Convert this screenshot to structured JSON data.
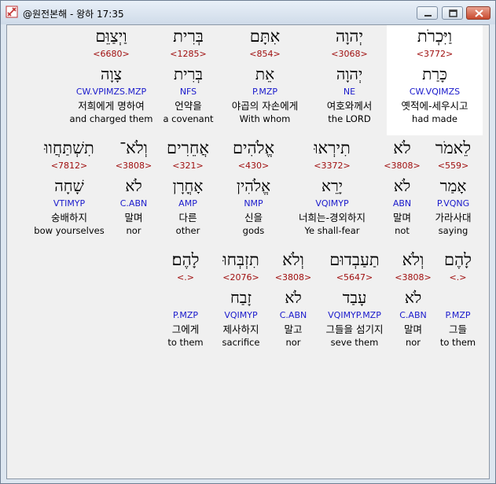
{
  "window": {
    "title": "@원전본해 - 왕하 17:35"
  },
  "rows": [
    {
      "words": [
        {
          "heb": "וַיִּכְרֹת",
          "num": "<3772>",
          "root": "כָּרַת",
          "pars": "CW.VQIMZS",
          "kor": "옛적에-세우시고",
          "eng": "had made",
          "selected": true
        },
        {
          "heb": "יְהוָה",
          "num": "<3068>",
          "root": "יְהוָה",
          "pars": "NE",
          "kor": "여호와께서",
          "eng": "the LORD"
        },
        {
          "heb": "אִתָּם",
          "num": "<854>",
          "root": "אֵת",
          "pars": "P.MZP",
          "kor": "야곱의 자손에게",
          "eng": "With whom"
        },
        {
          "heb": "בְּרִית",
          "num": "<1285>",
          "root": "בְּרִית",
          "pars": "NFS",
          "kor": "언약을",
          "eng": "a covenant"
        },
        {
          "heb": "וַיְצַוֵּם",
          "num": "<6680>",
          "root": "צָוָה",
          "pars": "CW.VPIMZS.MZP",
          "kor": "저희에게 명하여",
          "eng": "and charged them"
        }
      ]
    },
    {
      "words": [
        {
          "heb": "לֵאמֹר",
          "num": "<559>",
          "root": "אָמַר",
          "pars": "P.VQNG",
          "kor": "가라사대",
          "eng": "saying"
        },
        {
          "heb": "לֹא",
          "num": "<3808>",
          "root": "לֹא",
          "pars": "ABN",
          "kor": "말며",
          "eng": "not"
        },
        {
          "heb": "תִירְאוּ",
          "num": "<3372>",
          "root": "יָרֵא",
          "pars": "VQIMYP",
          "kor": "너희는-경외하지",
          "eng": "Ye shall-fear"
        },
        {
          "heb": "אֱלֹהִים",
          "num": "<430>",
          "root": "אֱלֹהִין",
          "pars": "NMP",
          "kor": "신을",
          "eng": "gods"
        },
        {
          "heb": "אֲחֵרִים",
          "num": "<321>",
          "root": "אָחֳרָן",
          "pars": "AMP",
          "kor": "다른",
          "eng": "other"
        },
        {
          "heb": "וְלֹא־",
          "num": "<3808>",
          "root": "לֹא",
          "pars": "C.ABN",
          "kor": "말며",
          "eng": "nor"
        },
        {
          "heb": "תִשְׁתַּחֲווּ",
          "num": "<7812>",
          "root": "שָׁחָה",
          "pars": "VTIMYP",
          "kor": "숭배하지",
          "eng": "bow yourselves"
        }
      ]
    },
    {
      "words": [
        {
          "heb": "לָהֶם",
          "num": "<.>",
          "root": "",
          "pars": "P.MZP",
          "kor": "그들",
          "eng": "to them"
        },
        {
          "heb": "וְלֹא",
          "num": "<3808>",
          "root": "לֹא",
          "pars": "C.ABN",
          "kor": "말며",
          "eng": "nor"
        },
        {
          "heb": "תַעַבְדוּם",
          "num": "<5647>",
          "root": "עָבַד",
          "pars": "VQIMYP.MZP",
          "kor": "그들을 섬기지",
          "eng": "seve them"
        },
        {
          "heb": "וְלֹא",
          "num": "<3808>",
          "root": "לֹא",
          "pars": "C.ABN",
          "kor": "말고",
          "eng": "nor"
        },
        {
          "heb": "תִזְבְּחוּ",
          "num": "<2076>",
          "root": "זָבַח",
          "pars": "VQIMYP",
          "kor": "제사하지",
          "eng": "sacrifice"
        },
        {
          "heb": "לָהֶם׃",
          "num": "<.>",
          "root": "",
          "pars": "P.MZP",
          "kor": "그에게",
          "eng": "to them"
        }
      ]
    }
  ]
}
